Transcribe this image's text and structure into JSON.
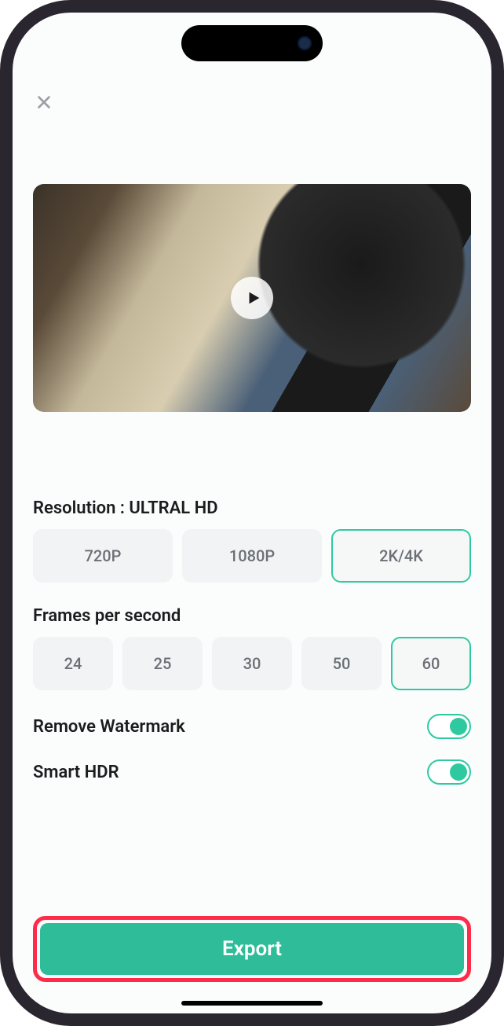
{
  "resolution": {
    "label": "Resolution : ULTRAL HD",
    "options": [
      "720P",
      "1080P",
      "2K/4K"
    ],
    "selected": "2K/4K"
  },
  "fps": {
    "label": "Frames per second",
    "options": [
      "24",
      "25",
      "30",
      "50",
      "60"
    ],
    "selected": "60"
  },
  "toggles": {
    "watermark": {
      "label": "Remove Watermark",
      "on": true
    },
    "hdr": {
      "label": "Smart HDR",
      "on": true
    }
  },
  "export_label": "Export",
  "colors": {
    "accent": "#2fc9a0",
    "highlight_box": "#ff2b4a"
  }
}
